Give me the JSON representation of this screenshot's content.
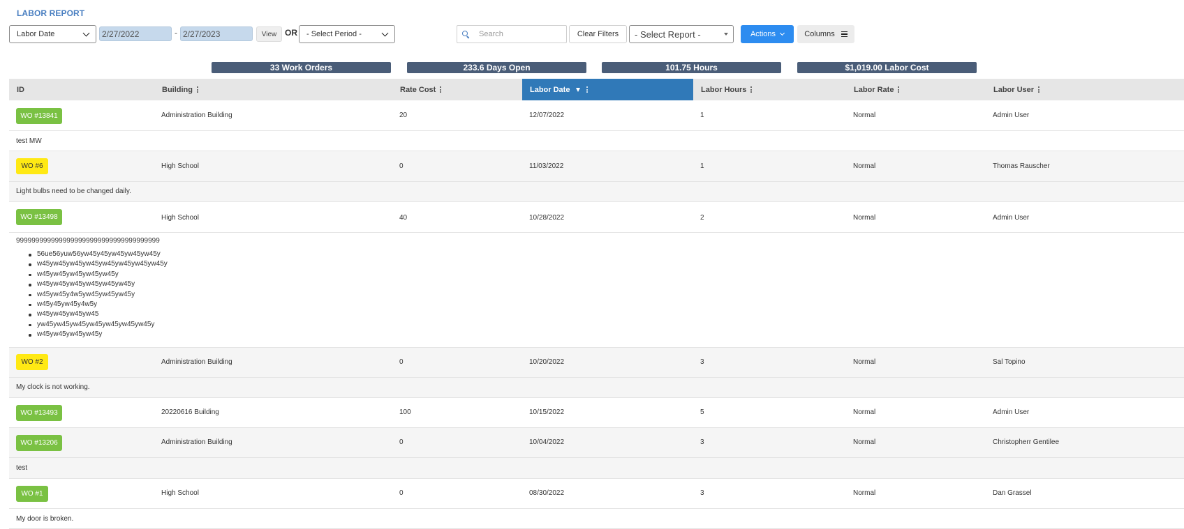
{
  "page": {
    "title": "LABOR REPORT"
  },
  "toolbar": {
    "date_type": "Labor Date",
    "date_from": "2/27/2022",
    "date_sep": "-",
    "date_to": "2/27/2023",
    "view_label": "View",
    "or_label": "OR",
    "period_placeholder": "- Select Period -",
    "search_placeholder": "Search",
    "clear_label": "Clear Filters",
    "report_placeholder": "- Select Report -",
    "actions_label": "Actions",
    "columns_label": "Columns"
  },
  "stats": {
    "work_orders": "33 Work Orders",
    "days_open": "233.6 Days Open",
    "hours": "101.75 Hours",
    "labor_cost": "$1,019.00 Labor Cost"
  },
  "table": {
    "columns": [
      "ID",
      "Building",
      "Rate Cost",
      "Labor Date",
      "Labor Hours",
      "Labor Rate",
      "Labor User"
    ],
    "sorted_column": "Labor Date",
    "rows": [
      {
        "wo": "WO #13841",
        "badge": "green",
        "building": "Administration Building",
        "rate_cost": "20",
        "labor_date": "12/07/2022",
        "hours": "1",
        "rate": "Normal",
        "user": "Admin User",
        "desc": "test MW"
      },
      {
        "wo": "WO #6",
        "badge": "yellow",
        "building": "High School",
        "rate_cost": "0",
        "labor_date": "11/03/2022",
        "hours": "1",
        "rate": "Normal",
        "user": "Thomas Rauscher",
        "desc": "Light bulbs need to be changed daily."
      },
      {
        "wo": "WO #13498",
        "badge": "green",
        "building": "High School",
        "rate_cost": "40",
        "labor_date": "10/28/2022",
        "hours": "2",
        "rate": "Normal",
        "user": "Admin User",
        "desc": "9999999999999999999999999999999999999",
        "bullets": [
          "56ue56yuw56yw45y45yw45yw45yw45y",
          "w45yw45yw45yw45yw45yw45yw45yw45y",
          "w45yw45yw45yw45yw45y",
          "w45yw45yw45yw45yw45yw45y",
          "w45yw45y4w5yw45yw45yw45y",
          "w45y45yw45y4w5y",
          "w45yw45yw45yw45",
          "yw45yw45yw45yw45yw45yw45yw45y",
          "w45yw45yw45yw45y"
        ]
      },
      {
        "wo": "WO #2",
        "badge": "yellow",
        "building": "Administration Building",
        "rate_cost": "0",
        "labor_date": "10/20/2022",
        "hours": "3",
        "rate": "Normal",
        "user": "Sal Topino",
        "desc": "My clock is not working."
      },
      {
        "wo": "WO #13493",
        "badge": "green",
        "building": "20220616 Building",
        "rate_cost": "100",
        "labor_date": "10/15/2022",
        "hours": "5",
        "rate": "Normal",
        "user": "Admin User",
        "desc": ""
      },
      {
        "wo": "WO #13206",
        "badge": "green",
        "building": "Administration Building",
        "rate_cost": "0",
        "labor_date": "10/04/2022",
        "hours": "3",
        "rate": "Normal",
        "user": "Christopherr Gentilee",
        "desc": "test"
      },
      {
        "wo": "WO #1",
        "badge": "green",
        "building": "High School",
        "rate_cost": "0",
        "labor_date": "08/30/2022",
        "hours": "3",
        "rate": "Normal",
        "user": "Dan Grassel",
        "desc": "My door is broken."
      }
    ]
  },
  "colors": {
    "accent": "#4a7fc1",
    "stat_bg": "#4a5d78",
    "active_header": "#3079b8",
    "badge_green": "#7ac143",
    "badge_yellow": "#ffe914",
    "actions_blue": "#2d8cf0"
  }
}
